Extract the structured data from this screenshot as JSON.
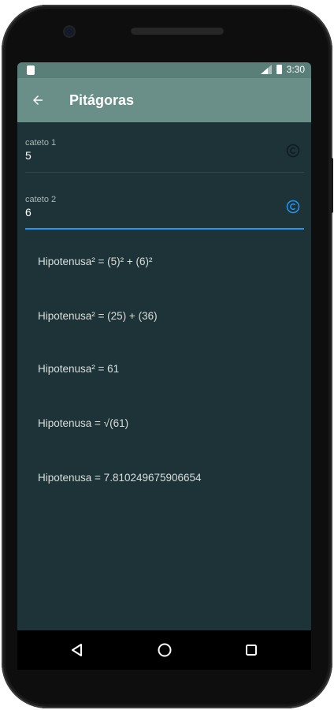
{
  "status": {
    "time": "3:30"
  },
  "appbar": {
    "title": "Pitágoras"
  },
  "fields": [
    {
      "label": "cateto 1",
      "value": "5"
    },
    {
      "label": "cateto 2",
      "value": "6"
    }
  ],
  "results": [
    "Hipotenusa² = (5)² + (6)²",
    "Hipotenusa² = (25) + (36)",
    "Hipotenusa² = 61",
    "Hipotenusa = √(61)",
    "Hipotenusa = 7.810249675906654"
  ],
  "colors": {
    "appbar": "#6a8f88",
    "statusbar": "#5a7f78",
    "background": "#1e3337",
    "accent": "#2196f3"
  },
  "icons": {
    "back": "arrow-back-icon",
    "clear": "copyright-c-icon",
    "nav_back": "triangle-back-icon",
    "nav_home": "circle-home-icon",
    "nav_recents": "square-recents-icon"
  }
}
